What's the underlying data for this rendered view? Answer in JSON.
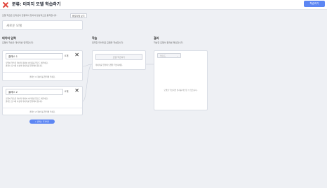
{
  "header": {
    "title": "분류: 이미지 모델 학습하기",
    "train_label": "학습하기"
  },
  "description": "모델 학습은 인터넷이 연결되어 있어야 정상적으로 동작합니다.",
  "learn_more_label": "튜토리얼 보기",
  "model_name_placeholder": "새로운 모델",
  "data_input": {
    "title": "데이터 입력",
    "subtitle": "모델이 학습할 데이터를 입력합니다."
  },
  "classes": [
    {
      "name": "클래스 1",
      "edit_label": "0개",
      "desc_line1": "모델이 학습할 데이터 대하여 이미지를 업로드 해주세요.",
      "desc_line2": "클래스 당 5개 이상의 데이터를 입력해야 합니다.",
      "footer": "클래스 1 데이터를 입력해 주세요."
    },
    {
      "name": "클래스 2",
      "edit_label": "0개",
      "desc_line1": "모델이 학습할 데이터 대하여 이미지를 업로드 해주세요.",
      "desc_line2": "클래스 당 5개 이상의 데이터를 입력해야 합니다.",
      "footer": "클래스 2 데이터를 입력해 주세요."
    }
  ],
  "add_class_label": "+ 클래스 추가하기",
  "training": {
    "title": "학습",
    "subtitle": "입력한 데이터로 모델을 학습합니다.",
    "button_label": "모델 학습하기",
    "note": "데이터를 입력해 모델을 학습하세요."
  },
  "result": {
    "title": "결과",
    "subtitle": "학습한 모델이 결과를 확인합니다.",
    "dropdown_label": "업로드",
    "empty_text": "모델을 학습하면 결과를 확인할 수 있습니다."
  },
  "colors": {
    "accent": "#5c86f3",
    "close": "#e0433a"
  }
}
